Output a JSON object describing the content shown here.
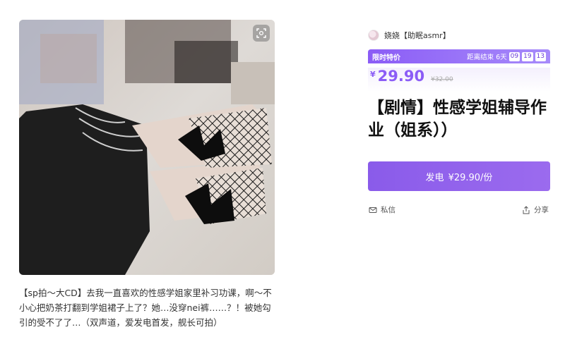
{
  "product": {
    "creator_name": "娆娆【助眠asmr】",
    "promo_label": "限时特价",
    "countdown_label": "距离结束",
    "countdown_days": "6天",
    "countdown_h": "09",
    "countdown_m": "19",
    "countdown_s": "13",
    "currency": "¥",
    "price": "29.90",
    "original_price": "¥32.00",
    "title": "【剧情】性感学姐辅导作业（姐系））",
    "buy_label": "发电",
    "buy_price": "¥29.90/份",
    "message_label": "私信",
    "share_label": "分享",
    "description": "【sp拍～大CD】去我一直喜欢的性感学姐家里补习功课，啊～不小心把奶茶打翻到学姐裙子上了？她…没穿nei裤……？！被她勾引的受不了了…（双声道，爱发电首发，舰长可拍）"
  },
  "icons": {
    "zoom": "zoom-icon",
    "message": "mail-icon",
    "share": "share-icon"
  },
  "colors": {
    "accent": "#8b5cf6",
    "button": "#9063ec"
  }
}
